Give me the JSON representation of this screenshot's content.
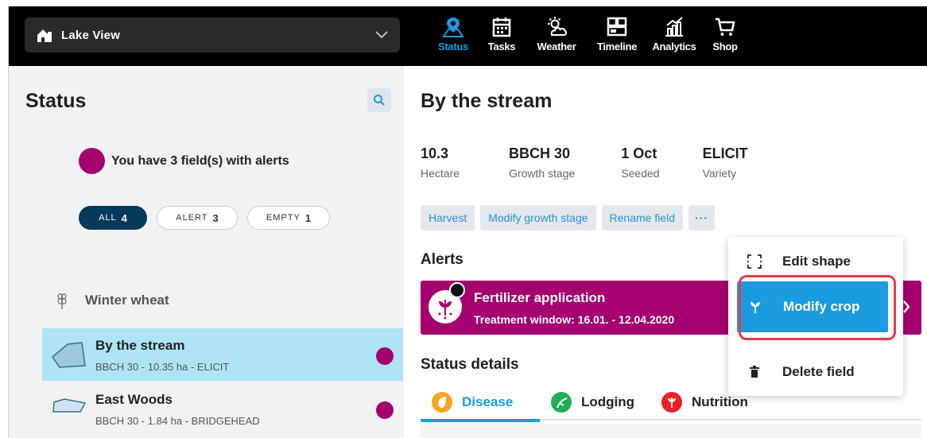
{
  "farm": {
    "name": "Lake View"
  },
  "nav": [
    {
      "label": "Status",
      "icon": "status-icon",
      "active": true
    },
    {
      "label": "Tasks",
      "icon": "calendar-icon"
    },
    {
      "label": "Weather",
      "icon": "weather-icon"
    },
    {
      "label": "Timeline",
      "icon": "timeline-icon"
    },
    {
      "label": "Analytics",
      "icon": "analytics-icon"
    },
    {
      "label": "Shop",
      "icon": "cart-icon"
    }
  ],
  "sidebar": {
    "title": "Status",
    "alert_summary": "You have 3 field(s) with alerts",
    "filters": [
      {
        "label": "ALL",
        "count": "4",
        "active": true
      },
      {
        "label": "ALERT",
        "count": "3"
      },
      {
        "label": "EMPTY",
        "count": "1"
      }
    ],
    "crop_group": "Winter wheat",
    "fields": [
      {
        "name": "By the stream",
        "meta": "BBCH 30 - 10.35 ha - ELICIT",
        "selected": true
      },
      {
        "name": "East Woods",
        "meta": "BBCH 30 - 1.84 ha - BRIDGEHEAD"
      }
    ]
  },
  "main": {
    "title": "By the stream",
    "stats": [
      {
        "value": "10.3",
        "label": "Hectare"
      },
      {
        "value": "BBCH 30",
        "label": "Growth stage"
      },
      {
        "value": "1 Oct",
        "label": "Seeded"
      },
      {
        "value": "ELICIT",
        "label": "Variety"
      }
    ],
    "actions": {
      "harvest": "Harvest",
      "modify_growth": "Modify growth stage",
      "rename": "Rename field",
      "more": "···"
    },
    "alerts_title": "Alerts",
    "alert": {
      "title": "Fertilizer application",
      "window": "Treatment window: 16.01. - 12.04.2020"
    },
    "status_details_title": "Status details",
    "tabs": [
      {
        "label": "Disease",
        "color": "#f5a623",
        "active": true
      },
      {
        "label": "Lodging",
        "color": "#1fae55"
      },
      {
        "label": "Nutrition",
        "color": "#e8202a"
      }
    ]
  },
  "menu": {
    "edit_shape": "Edit shape",
    "modify_crop": "Modify crop",
    "delete_field": "Delete field"
  },
  "colors": {
    "accent": "#1a9be0",
    "alert": "#a4006f",
    "highlight_ring": "#e23b4b"
  }
}
